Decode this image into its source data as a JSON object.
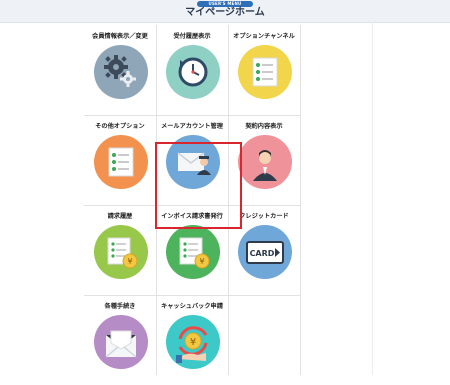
{
  "header": {
    "badge": "USER'S MENU",
    "title": "マイページホーム"
  },
  "colors": {
    "highlight": "#d9252d",
    "header_badge": "#2d6fb8"
  },
  "tiles": [
    {
      "label": "会員情報表示／変更",
      "icon": "gear-icon",
      "circle_color": "#8fa6b8"
    },
    {
      "label": "受付履歴表示",
      "icon": "history-clock-icon",
      "circle_color": "#8fd0c4"
    },
    {
      "label": "オプションチャンネル",
      "icon": "checklist-icon",
      "circle_color": "#f2d54a"
    },
    {
      "label": "その他オプション",
      "icon": "checklist-icon",
      "circle_color": "#f2924e",
      "highlighted": true
    },
    {
      "label": "メールアカウント管理",
      "icon": "mail-envelope-icon",
      "circle_color": "#6fa7d9"
    },
    {
      "label": "契約内容表示",
      "icon": "person-icon",
      "circle_color": "#f0929a"
    },
    {
      "label": "請求履歴",
      "icon": "invoice-yen-icon",
      "circle_color": "#97c84a"
    },
    {
      "label": "インボイス請求書発行",
      "icon": "invoice-yen-icon",
      "circle_color": "#4db35d"
    },
    {
      "label": "クレジットカード",
      "icon": "credit-card-icon",
      "circle_color": "#6fa7d9"
    },
    {
      "label": "各種手続き",
      "icon": "envelope-icon",
      "circle_color": "#b58cc6"
    },
    {
      "label": "キャッシュバック申請",
      "icon": "cashback-yen-icon",
      "circle_color": "#3cc9c7"
    }
  ],
  "card_icon_text": "CARD",
  "yen_symbol": "¥"
}
